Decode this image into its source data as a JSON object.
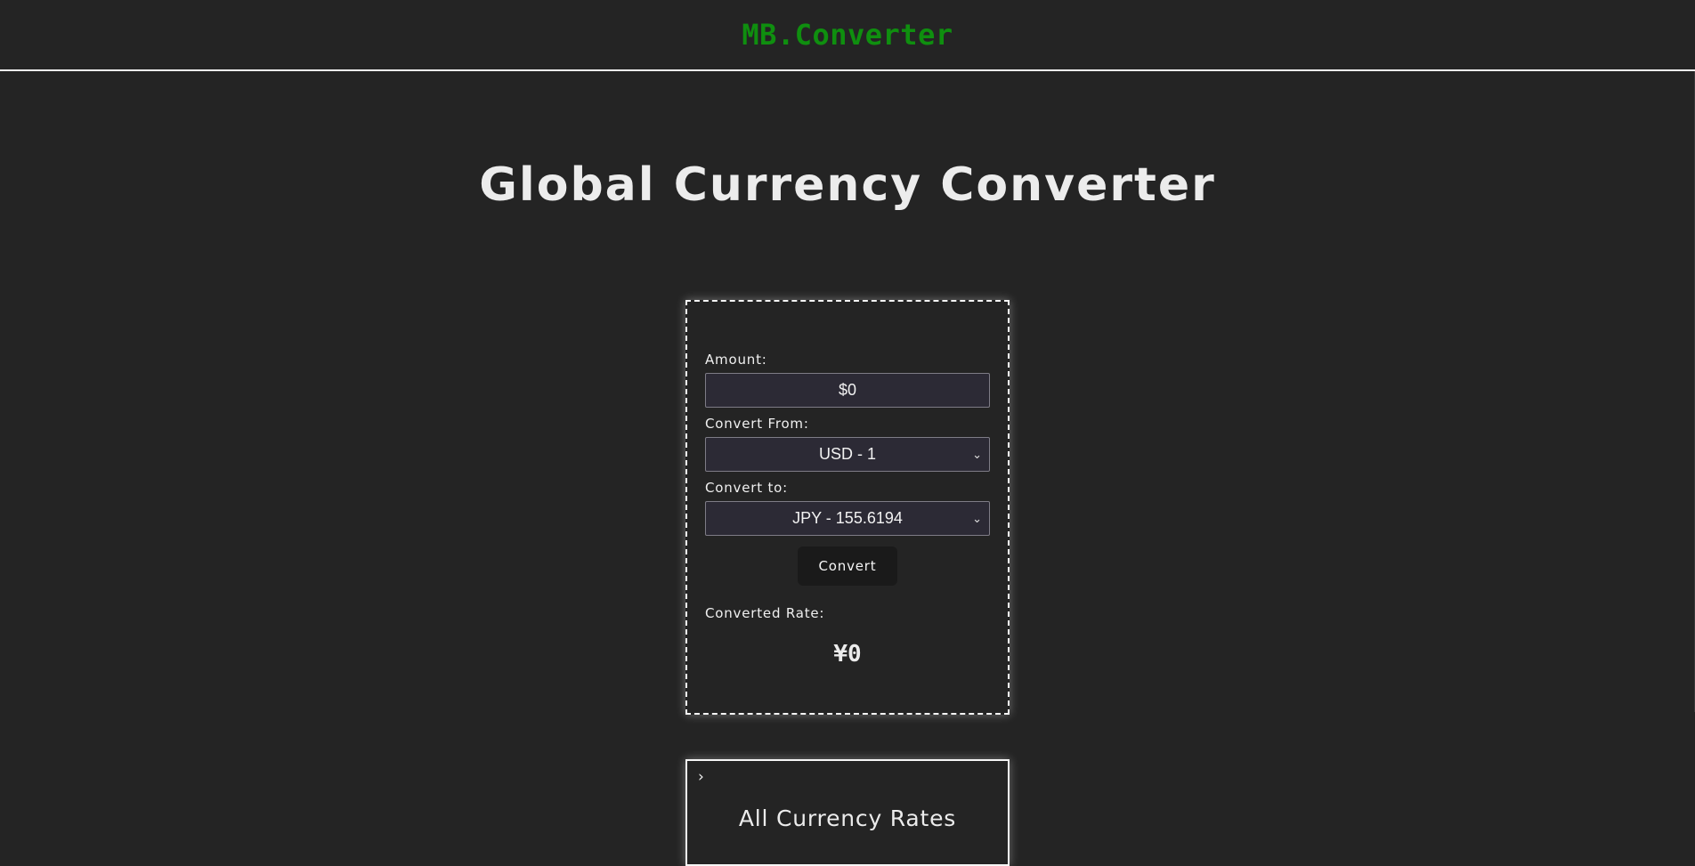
{
  "header": {
    "brand": "MB.Converter"
  },
  "main": {
    "title": "Global Currency Converter"
  },
  "converter": {
    "amount_label": "Amount:",
    "amount_value": "$0",
    "from_label": "Convert From:",
    "from_selected": "USD - 1",
    "to_label": "Convert to:",
    "to_selected": "JPY - 155.6194",
    "convert_button": "Convert",
    "result_label": "Converted Rate:",
    "result_value": "¥0"
  },
  "rates": {
    "toggle_icon": "chevron-right-icon",
    "toggle_glyph": "›",
    "title": "All Currency Rates"
  },
  "colors": {
    "background": "#242424",
    "brand": "#0f8f0f",
    "field_bg": "#2c2a35",
    "button_bg": "#1a1a1a"
  }
}
